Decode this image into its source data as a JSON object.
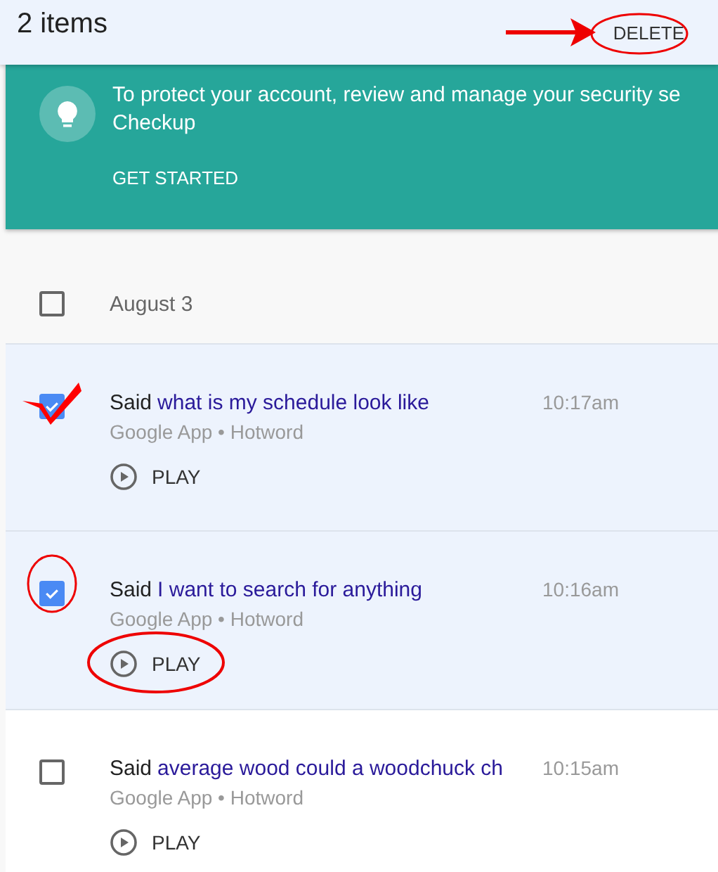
{
  "header": {
    "count": "2 items",
    "action": "DELETE"
  },
  "banner": {
    "lines": [
      "To protect your account, review and manage your security se",
      "Checkup"
    ],
    "action": "GET STARTED"
  },
  "date_group": {
    "label": "August 3",
    "checked": false
  },
  "items": [
    {
      "selected": true,
      "prefix": "Said",
      "query": "what is my schedule look like",
      "time": "10:17am",
      "source": "Google App • Hotword",
      "play": "PLAY"
    },
    {
      "selected": true,
      "prefix": "Said",
      "query": "I want to search for anything",
      "time": "10:16am",
      "source": "Google App • Hotword",
      "play": "PLAY"
    },
    {
      "selected": false,
      "prefix": "Said",
      "query": "average wood could a woodchuck ch",
      "time": "10:15am",
      "source": "Google App • Hotword",
      "play": "PLAY"
    }
  ]
}
